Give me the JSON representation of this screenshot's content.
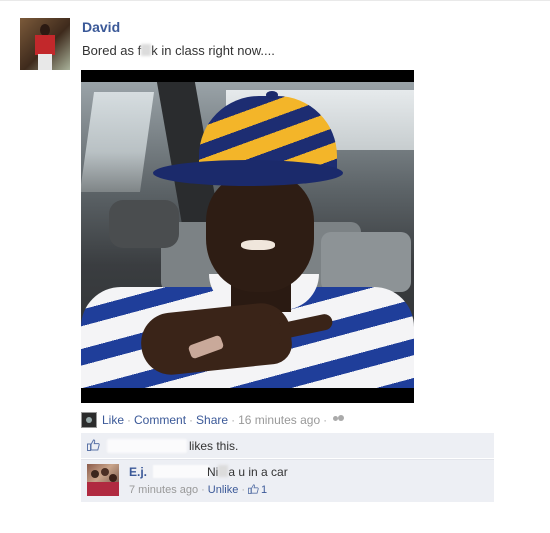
{
  "post": {
    "author": "David",
    "status_prefix": "Bored as f",
    "status_suffix": "k in class right now....",
    "photo_alt": "Photo of a man in a car wearing a blue and gold cap and striped shirt"
  },
  "actions": {
    "like": "Like",
    "comment": "Comment",
    "share": "Share",
    "timestamp": "16 minutes ago",
    "separator": "·"
  },
  "likes": {
    "text": "likes this."
  },
  "comment": {
    "author": "E.j.",
    "text_prefix": "Ni",
    "text_suffix": "a u in a car",
    "timestamp": "7 minutes ago",
    "unlike": "Unlike",
    "like_count": "1"
  },
  "colors": {
    "link": "#3b5998",
    "panel": "#edeff4",
    "meta": "#999999"
  }
}
